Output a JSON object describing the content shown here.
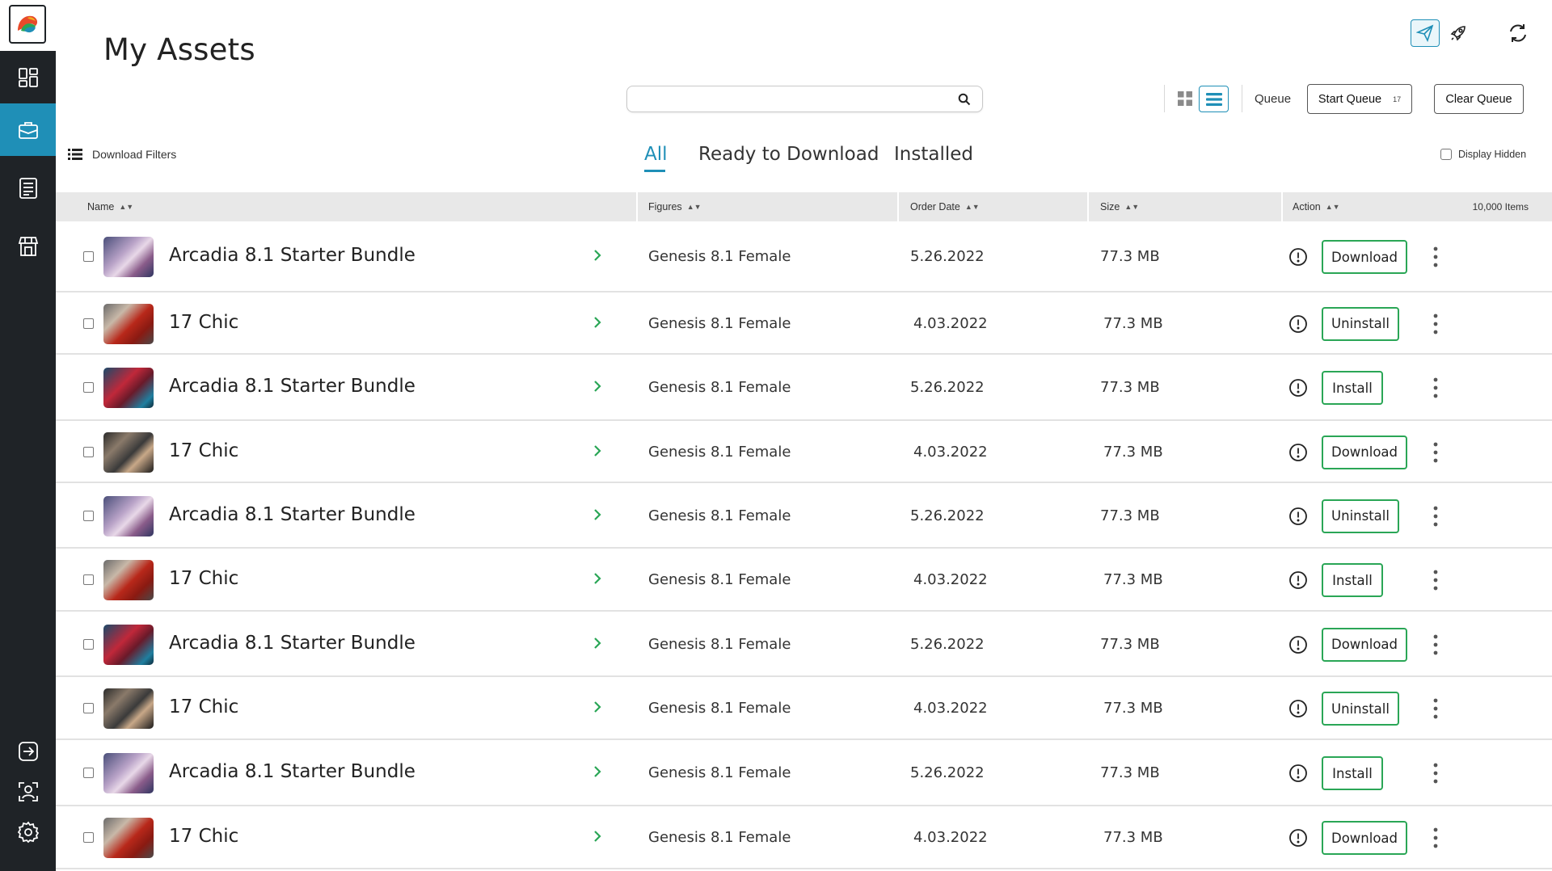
{
  "page": {
    "title": "My Assets"
  },
  "search": {
    "value": "",
    "placeholder": ""
  },
  "toolbar": {
    "queue_label": "Queue",
    "start_queue_label": "Start Queue",
    "start_queue_count": "17",
    "clear_queue_label": "Clear Queue"
  },
  "filters": {
    "label": "Download Filters"
  },
  "tabs": [
    {
      "label": "All",
      "active": true
    },
    {
      "label": "Ready to Download",
      "active": false
    },
    {
      "label": "Installed",
      "active": false
    }
  ],
  "display_hidden": {
    "label": "Display Hidden",
    "checked": false
  },
  "table": {
    "columns": [
      "Name",
      "Figures",
      "Order Date",
      "Size",
      "Action"
    ],
    "items_count": "10,000 Items",
    "rows": [
      {
        "name": "Arcadia 8.1 Starter Bundle",
        "figures": "Genesis 8.1 Female",
        "date": "5.26.2022",
        "size": "77.3 MB",
        "action": "Download",
        "thumb": "arcadia-light"
      },
      {
        "name": "17 Chic",
        "figures": "Genesis 8.1 Female",
        "date": "4.03.2022",
        "size": "77.3 MB",
        "action": "Uninstall",
        "thumb": "chic-red"
      },
      {
        "name": "Arcadia 8.1 Starter Bundle",
        "figures": "Genesis 8.1 Female",
        "date": "5.26.2022",
        "size": "77.3 MB",
        "action": "Install",
        "thumb": "arcadia-dark"
      },
      {
        "name": "17 Chic",
        "figures": "Genesis 8.1 Female",
        "date": "4.03.2022",
        "size": "77.3 MB",
        "action": "Download",
        "thumb": "chic-dark"
      },
      {
        "name": "Arcadia 8.1 Starter Bundle",
        "figures": "Genesis 8.1 Female",
        "date": "5.26.2022",
        "size": "77.3 MB",
        "action": "Uninstall",
        "thumb": "arcadia-light"
      },
      {
        "name": "17 Chic",
        "figures": "Genesis 8.1 Female",
        "date": "4.03.2022",
        "size": "77.3 MB",
        "action": "Install",
        "thumb": "chic-red"
      },
      {
        "name": "Arcadia 8.1 Starter Bundle",
        "figures": "Genesis 8.1 Female",
        "date": "5.26.2022",
        "size": "77.3 MB",
        "action": "Download",
        "thumb": "arcadia-dark"
      },
      {
        "name": "17 Chic",
        "figures": "Genesis 8.1 Female",
        "date": "4.03.2022",
        "size": "77.3 MB",
        "action": "Uninstall",
        "thumb": "chic-dark"
      },
      {
        "name": "Arcadia 8.1 Starter Bundle",
        "figures": "Genesis 8.1 Female",
        "date": "5.26.2022",
        "size": "77.3 MB",
        "action": "Install",
        "thumb": "arcadia-light"
      },
      {
        "name": "17 Chic",
        "figures": "Genesis 8.1 Female",
        "date": "4.03.2022",
        "size": "77.3 MB",
        "action": "Download",
        "thumb": "chic-red"
      }
    ]
  },
  "sidebar": {
    "items": [
      {
        "icon": "dashboard-icon",
        "active": false
      },
      {
        "icon": "briefcase-icon",
        "active": true
      },
      {
        "icon": "document-list-icon",
        "active": false
      },
      {
        "icon": "store-icon",
        "active": false
      }
    ],
    "bottom_items": [
      {
        "icon": "sign-out-icon"
      },
      {
        "icon": "profile-icon"
      },
      {
        "icon": "gear-icon"
      }
    ]
  },
  "colors": {
    "accent": "#1f8fb7",
    "action_border": "#2aa656",
    "chevron": "#2aa656",
    "sidebar": "#1f2327"
  }
}
